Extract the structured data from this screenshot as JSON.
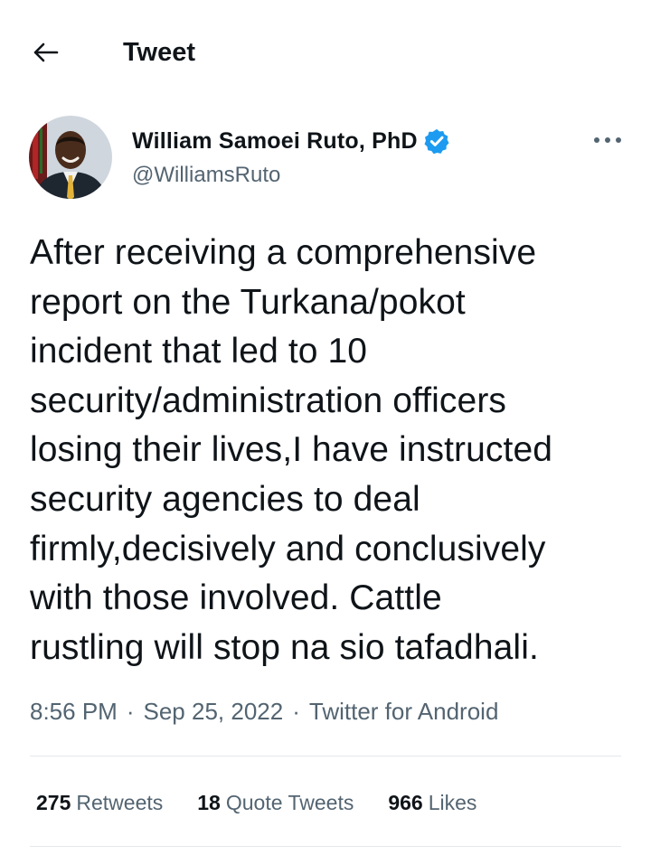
{
  "header": {
    "title": "Tweet",
    "back_icon": "arrow-left-icon"
  },
  "author": {
    "display_name": "William Samoei Ruto, PhD",
    "handle": "@WilliamsRuto",
    "verified": true,
    "verified_color": "#1d9bf0"
  },
  "tweet": {
    "text": "After receiving a comprehensive\nreport on the Turkana/pokot\nincident that led to 10\nsecurity/administration officers\nlosing their lives,I have instructed\nsecurity agencies to deal\nfirmly,decisively and conclusively\nwith those involved. Cattle\nrustling will stop na sio tafadhali.",
    "time": "8:56 PM",
    "date": "Sep 25, 2022",
    "source": "Twitter for Android"
  },
  "stats": {
    "retweets": {
      "count": "275",
      "label": "Retweets"
    },
    "quotes": {
      "count": "18",
      "label": "Quote Tweets"
    },
    "likes": {
      "count": "966",
      "label": "Likes"
    }
  },
  "colors": {
    "text_primary": "#0f1419",
    "text_secondary": "#536471",
    "divider": "#e4e8eb",
    "accent": "#1d9bf0"
  }
}
